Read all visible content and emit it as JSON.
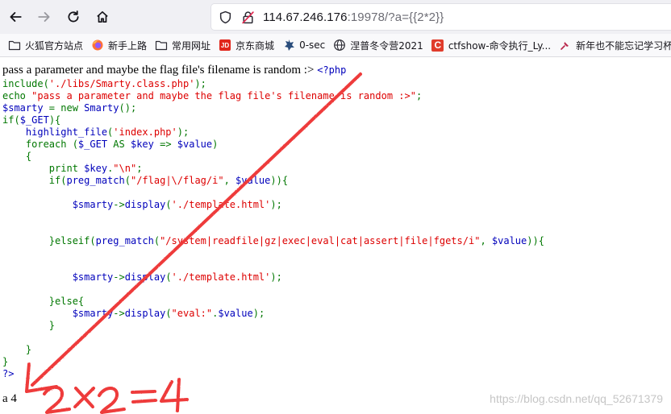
{
  "browser": {
    "url_host": "114.67.246.176",
    "url_rest": ":19978/?a={{2*2}}",
    "icons": {
      "back": "arrow-left-icon",
      "forward": "arrow-right-icon",
      "reload": "reload-icon",
      "home": "home-icon",
      "shield": "shield-icon",
      "insecure": "insecure-lock-icon"
    }
  },
  "bookmarks": [
    {
      "label": "火狐官方站点",
      "icon": "folder-icon"
    },
    {
      "label": "新手上路",
      "icon": "firefox-icon"
    },
    {
      "label": "常用网址",
      "icon": "folder-icon"
    },
    {
      "label": "京东商城",
      "icon": "jd-icon",
      "badge": "JD"
    },
    {
      "label": "0-sec",
      "icon": "0sec-icon"
    },
    {
      "label": "涅普冬令营2021",
      "icon": "globe-icon"
    },
    {
      "label": "ctfshow-命令执行_Ly...",
      "icon": "ctfshow-icon",
      "badge": "C"
    },
    {
      "label": "新年也不能忘记学习杯",
      "icon": "pin-icon"
    }
  ],
  "page": {
    "intro": "pass a parameter and maybe the flag file's filename is random :> ",
    "output": "a 4",
    "watermark": "https://blog.csdn.net/qq_52671379",
    "code_lines": [
      [
        {
          "t": "<?php",
          "c": "php"
        }
      ],
      [
        {
          "t": "include(",
          "c": "kw"
        },
        {
          "t": "'./libs/Smarty.class.php'",
          "c": "str"
        },
        {
          "t": ");",
          "c": "kw"
        }
      ],
      [
        {
          "t": "echo ",
          "c": "kw"
        },
        {
          "t": "\"pass a parameter and maybe the flag file's filename is random :>\"",
          "c": "str"
        },
        {
          "t": ";",
          "c": "kw"
        }
      ],
      [
        {
          "t": "$smarty ",
          "c": "def"
        },
        {
          "t": "= new ",
          "c": "kw"
        },
        {
          "t": "Smarty",
          "c": "def"
        },
        {
          "t": "();",
          "c": "kw"
        }
      ],
      [
        {
          "t": "if(",
          "c": "kw"
        },
        {
          "t": "$_GET",
          "c": "def"
        },
        {
          "t": "){",
          "c": "kw"
        }
      ],
      [
        {
          "t": "    highlight_file",
          "c": "def"
        },
        {
          "t": "(",
          "c": "kw"
        },
        {
          "t": "'index.php'",
          "c": "str"
        },
        {
          "t": ");",
          "c": "kw"
        }
      ],
      [
        {
          "t": "    foreach (",
          "c": "kw"
        },
        {
          "t": "$_GET ",
          "c": "def"
        },
        {
          "t": "AS ",
          "c": "kw"
        },
        {
          "t": "$key ",
          "c": "def"
        },
        {
          "t": "=> ",
          "c": "kw"
        },
        {
          "t": "$value",
          "c": "def"
        },
        {
          "t": ")",
          "c": "kw"
        }
      ],
      [
        {
          "t": "    {",
          "c": "kw"
        }
      ],
      [
        {
          "t": "        print ",
          "c": "kw"
        },
        {
          "t": "$key",
          "c": "def"
        },
        {
          "t": ".",
          "c": "kw"
        },
        {
          "t": "\"\\n\"",
          "c": "str"
        },
        {
          "t": ";",
          "c": "kw"
        }
      ],
      [
        {
          "t": "        if(",
          "c": "kw"
        },
        {
          "t": "preg_match",
          "c": "def"
        },
        {
          "t": "(",
          "c": "kw"
        },
        {
          "t": "\"/flag|\\/flag/i\"",
          "c": "str"
        },
        {
          "t": ", ",
          "c": "kw"
        },
        {
          "t": "$value",
          "c": "def"
        },
        {
          "t": ")){",
          "c": "kw"
        }
      ],
      [],
      [
        {
          "t": "            $smarty",
          "c": "def"
        },
        {
          "t": "->",
          "c": "kw"
        },
        {
          "t": "display",
          "c": "def"
        },
        {
          "t": "(",
          "c": "kw"
        },
        {
          "t": "'./template.html'",
          "c": "str"
        },
        {
          "t": ");",
          "c": "kw"
        }
      ],
      [],
      [],
      [
        {
          "t": "        }elseif(",
          "c": "kw"
        },
        {
          "t": "preg_match",
          "c": "def"
        },
        {
          "t": "(",
          "c": "kw"
        },
        {
          "t": "\"/system|readfile|gz|exec|eval|cat|assert|file|fgets/i\"",
          "c": "str"
        },
        {
          "t": ", ",
          "c": "kw"
        },
        {
          "t": "$value",
          "c": "def"
        },
        {
          "t": ")){",
          "c": "kw"
        }
      ],
      [],
      [],
      [
        {
          "t": "            $smarty",
          "c": "def"
        },
        {
          "t": "->",
          "c": "kw"
        },
        {
          "t": "display",
          "c": "def"
        },
        {
          "t": "(",
          "c": "kw"
        },
        {
          "t": "'./template.html'",
          "c": "str"
        },
        {
          "t": ");",
          "c": "kw"
        }
      ],
      [],
      [
        {
          "t": "        }else{",
          "c": "kw"
        }
      ],
      [
        {
          "t": "            $smarty",
          "c": "def"
        },
        {
          "t": "->",
          "c": "kw"
        },
        {
          "t": "display",
          "c": "def"
        },
        {
          "t": "(",
          "c": "kw"
        },
        {
          "t": "\"eval:\"",
          "c": "str"
        },
        {
          "t": ".",
          "c": "kw"
        },
        {
          "t": "$value",
          "c": "def"
        },
        {
          "t": ");",
          "c": "kw"
        }
      ],
      [
        {
          "t": "        }",
          "c": "kw"
        }
      ],
      [],
      [
        {
          "t": "    }",
          "c": "kw"
        }
      ],
      [
        {
          "t": "}",
          "c": "kw"
        }
      ],
      [
        {
          "t": "?>",
          "c": "php"
        }
      ]
    ]
  },
  "annotation": {
    "handwritten": "2×2=4",
    "color": "#ee3b3b"
  }
}
